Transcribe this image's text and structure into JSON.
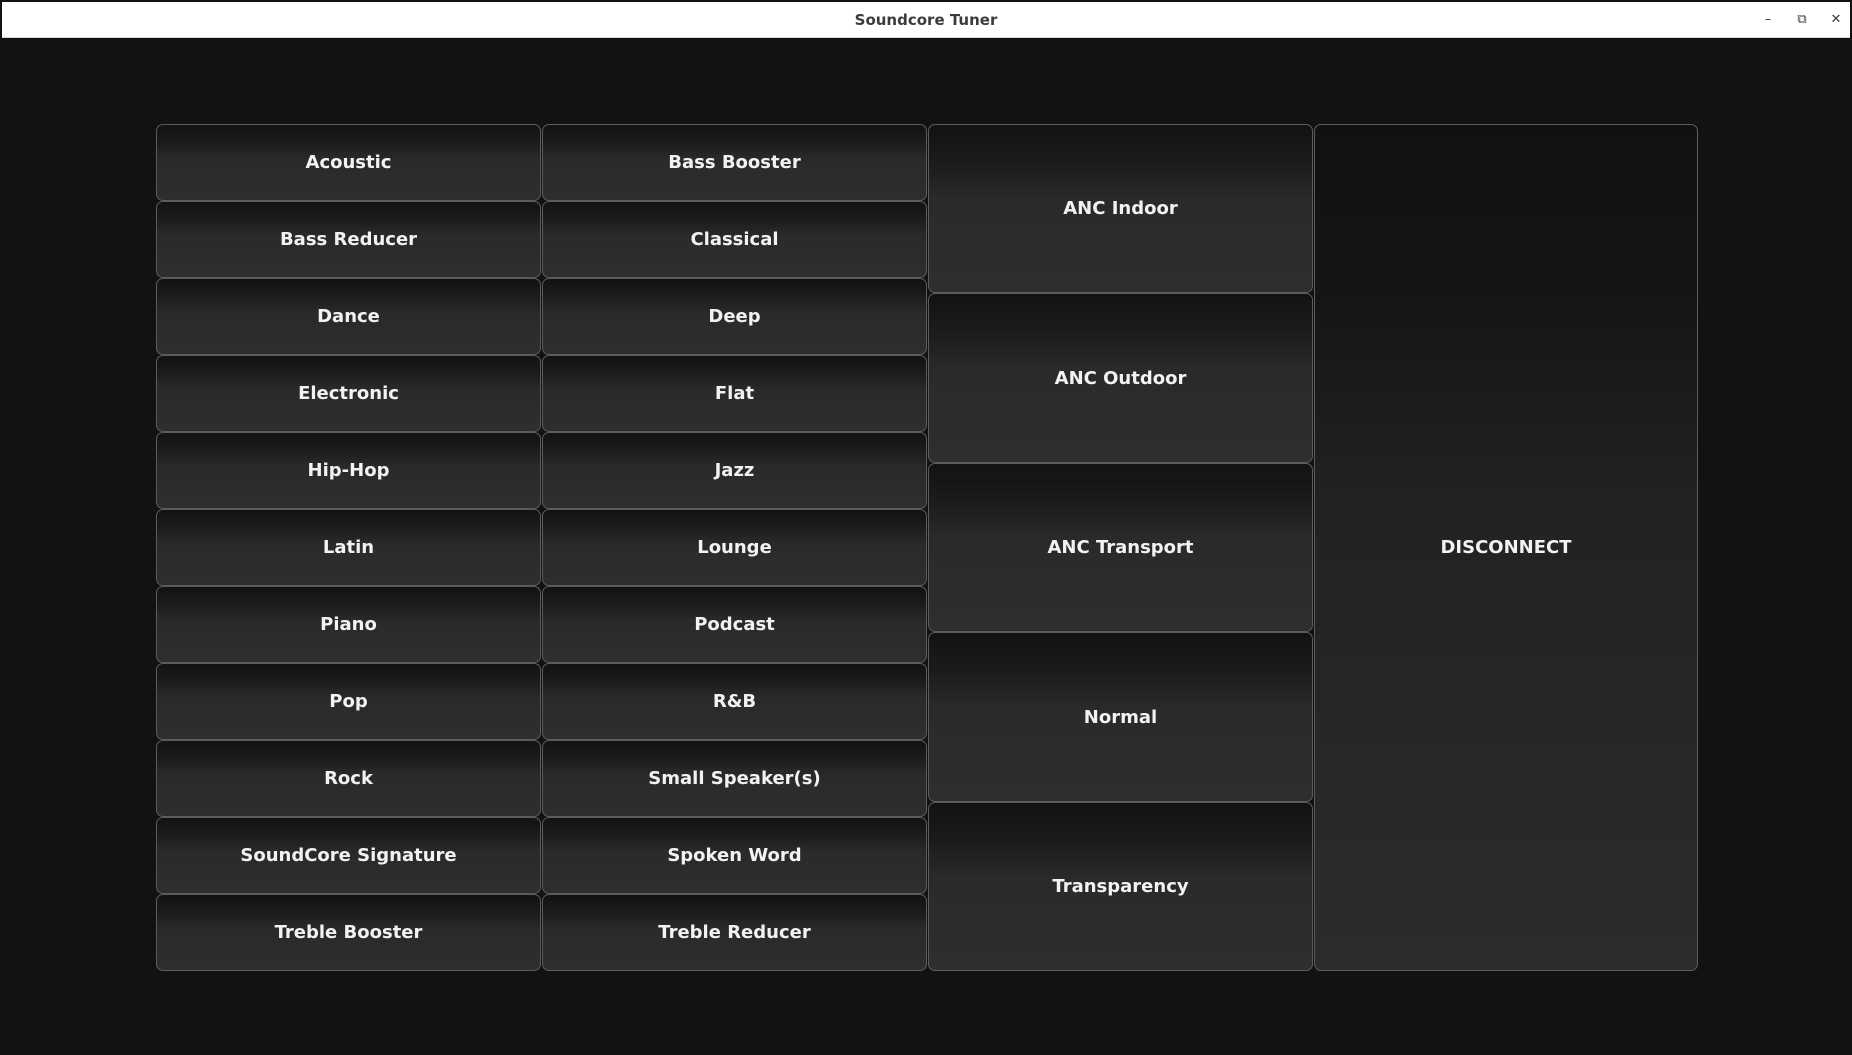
{
  "window": {
    "title": "Soundcore Tuner",
    "min_icon": "–",
    "max_icon": "⧉",
    "close_icon": "✕"
  },
  "eq_presets": {
    "left": [
      "Acoustic",
      "Bass Reducer",
      "Dance",
      "Electronic",
      "Hip-Hop",
      "Latin",
      "Piano",
      "Pop",
      "Rock",
      "SoundCore Signature",
      "Treble Booster"
    ],
    "right": [
      "Bass Booster",
      "Classical",
      "Deep",
      "Flat",
      "Jazz",
      "Lounge",
      "Podcast",
      "R&B",
      "Small Speaker(s)",
      "Spoken Word",
      "Treble Reducer"
    ]
  },
  "anc_modes": [
    "ANC Indoor",
    "ANC Outdoor",
    "ANC Transport",
    "Normal",
    "Transparency"
  ],
  "disconnect_label": "DISCONNECT",
  "colors": {
    "background": "#121212",
    "button_text": "#f2f2f2",
    "button_border": "#5c5c5c"
  }
}
